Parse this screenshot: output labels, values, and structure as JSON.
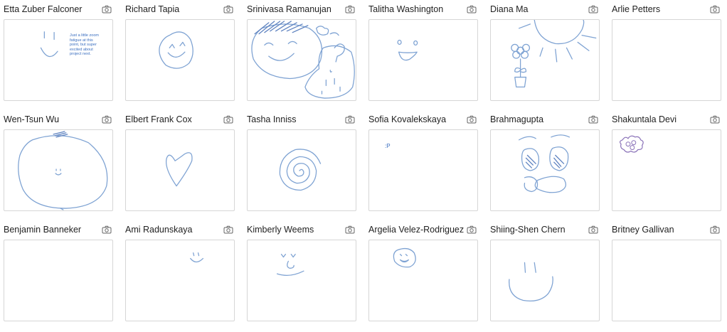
{
  "participants": [
    {
      "name": "Etta Zuber Falconer",
      "board_text": "Just a little zoom fatigue at this point, but super excited about project next."
    },
    {
      "name": "Richard Tapia"
    },
    {
      "name": "Srinivasa Ramanujan"
    },
    {
      "name": "Talitha Washington"
    },
    {
      "name": "Diana Ma"
    },
    {
      "name": "Arlie Petters"
    },
    {
      "name": "Wen-Tsun Wu"
    },
    {
      "name": "Elbert Frank Cox"
    },
    {
      "name": "Tasha Inniss"
    },
    {
      "name": "Sofia Kovalekskaya",
      "board_text": ":P"
    },
    {
      "name": "Brahmagupta"
    },
    {
      "name": "Shakuntala Devi"
    },
    {
      "name": "Benjamin Banneker"
    },
    {
      "name": "Ami Radunskaya"
    },
    {
      "name": "Kimberly Weems"
    },
    {
      "name": "Argelia Velez-Rodriguez"
    },
    {
      "name": "Shiing-Shen Chern"
    },
    {
      "name": "Britney Gallivan"
    }
  ],
  "icons": {
    "snapshot": "camera-icon"
  },
  "colors": {
    "ink": "#7fa3d3",
    "border": "#d6d6d6"
  }
}
